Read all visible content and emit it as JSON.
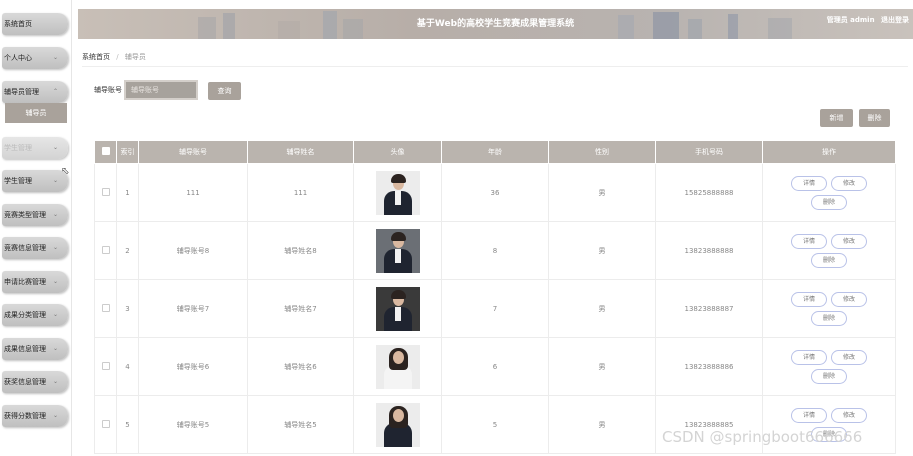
{
  "header": {
    "title": "基于Web的高校学生竞赛成果管理系统",
    "user": "管理员 admin",
    "logout": "退出登录"
  },
  "sidebar": {
    "items": [
      {
        "label": "系统首页",
        "has_arrow": false
      },
      {
        "label": "个人中心",
        "has_arrow": true
      },
      {
        "label": "辅导员管理",
        "has_arrow": true
      },
      {
        "label": "学生管理",
        "has_arrow": true
      },
      {
        "label": "学生管理",
        "has_arrow": true
      },
      {
        "label": "竞赛类型管理",
        "has_arrow": true
      },
      {
        "label": "竞赛信息管理",
        "has_arrow": true
      },
      {
        "label": "申请比赛管理",
        "has_arrow": true
      },
      {
        "label": "成果分类管理",
        "has_arrow": true
      },
      {
        "label": "成果信息管理",
        "has_arrow": true
      },
      {
        "label": "获奖信息管理",
        "has_arrow": true
      },
      {
        "label": "获得分数管理",
        "has_arrow": true
      }
    ],
    "submenu_label": "辅导员"
  },
  "breadcrumb": {
    "home": "系统首页",
    "separator": "/",
    "current": "辅导员"
  },
  "search": {
    "label": "辅导账号",
    "placeholder": "辅导账号",
    "button": "查询"
  },
  "toolbar": {
    "add": "新增",
    "delete": "删除"
  },
  "table": {
    "headers": [
      "索引",
      "辅导账号",
      "辅导姓名",
      "头像",
      "年龄",
      "性别",
      "手机号码",
      "操作"
    ],
    "rows": [
      {
        "index": "1",
        "account": "111",
        "name": "111",
        "age": "36",
        "gender": "男",
        "phone": "15825888888",
        "avatar": "man-dark-suit-photo"
      },
      {
        "index": "2",
        "account": "辅导账号8",
        "name": "辅导姓名8",
        "age": "8",
        "gender": "男",
        "phone": "13823888888",
        "avatar": "man-grey-background-photo"
      },
      {
        "index": "3",
        "account": "辅导账号7",
        "name": "辅导姓名7",
        "age": "7",
        "gender": "男",
        "phone": "13823888887",
        "avatar": "man-standing-photo"
      },
      {
        "index": "4",
        "account": "辅导账号6",
        "name": "辅导姓名6",
        "age": "6",
        "gender": "男",
        "phone": "13823888886",
        "avatar": "woman-white-shirt-photo"
      },
      {
        "index": "5",
        "account": "辅导账号5",
        "name": "辅导姓名5",
        "age": "5",
        "gender": "男",
        "phone": "13823888885",
        "avatar": "woman-dark-suit-photo"
      }
    ],
    "op_labels": {
      "detail": "详情",
      "edit": "修改",
      "delete": "删除"
    }
  },
  "watermark": "CSDN @springboot666666",
  "colors": {
    "accent": "#a9a29b",
    "table_header": "#bab4ae",
    "op_border": "#b9c2e8"
  }
}
